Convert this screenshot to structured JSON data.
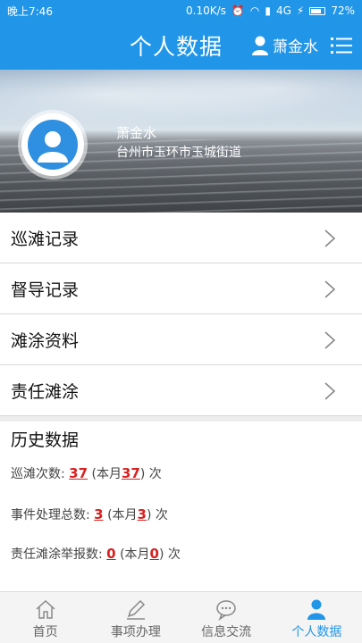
{
  "status_bar": {
    "time": "晚上7:46",
    "net_speed": "0.10K/s",
    "network": "4G",
    "battery": "72%"
  },
  "header": {
    "title": "个人数据",
    "user_name": "萧金水",
    "menu_icon": "list-menu-icon"
  },
  "profile": {
    "name": "萧金水",
    "address": "台州市玉环市玉城街道",
    "avatar_icon": "person-avatar-icon"
  },
  "menu": {
    "items": [
      {
        "label": "巡滩记录"
      },
      {
        "label": "督导记录"
      },
      {
        "label": "滩涂资料"
      },
      {
        "label": "责任滩涂"
      }
    ]
  },
  "history": {
    "title": "历史数据",
    "patrol": {
      "label": "巡滩次数:",
      "total": "37",
      "month_label": "本月",
      "month": "37",
      "unit": "次"
    },
    "events": {
      "label": "事件处理总数:",
      "total": "3",
      "month_label": "本月",
      "month": "3",
      "unit": "次"
    },
    "reports": {
      "label": "责任滩涂举报数:",
      "total": "0",
      "month_label": "本月",
      "month": "0",
      "unit": "次"
    }
  },
  "bottom_nav": {
    "items": [
      {
        "label": "首页",
        "icon": "home-icon"
      },
      {
        "label": "事项办理",
        "icon": "pen-icon"
      },
      {
        "label": "信息交流",
        "icon": "chat-bubble-icon"
      },
      {
        "label": "个人数据",
        "icon": "person-icon",
        "active": true
      }
    ]
  },
  "colors": {
    "primary": "#2196e8",
    "highlight_number": "#d82020"
  }
}
